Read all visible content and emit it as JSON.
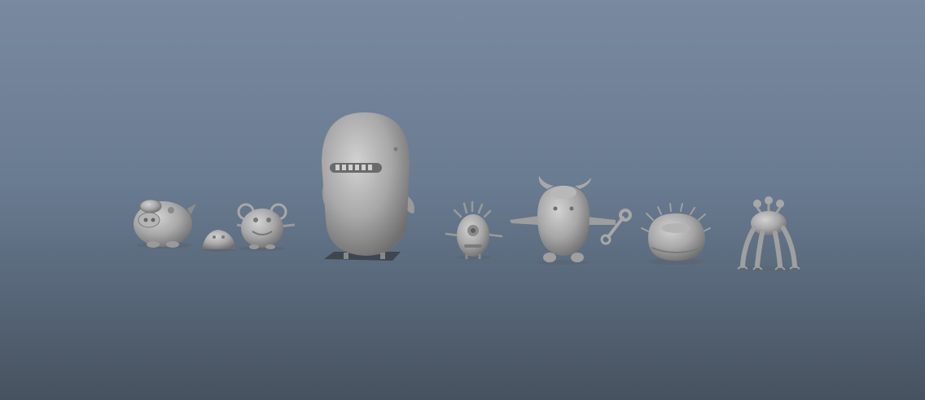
{
  "viewport": {
    "background_top": "#7889a0",
    "background_bottom": "#46525f",
    "model_color": "#a6a6a6"
  },
  "models": [
    {
      "id": "pig-monster",
      "name": "pig-monster-model"
    },
    {
      "id": "small-blob",
      "name": "small-blob-model"
    },
    {
      "id": "mouse-monster",
      "name": "mouse-monster-model"
    },
    {
      "id": "big-whale-monster",
      "name": "big-whale-monster-model"
    },
    {
      "id": "spiky-cyclops",
      "name": "spiky-cyclops-model"
    },
    {
      "id": "horned-wrench-monster",
      "name": "horned-wrench-monster-model"
    },
    {
      "id": "spiky-puffer",
      "name": "spiky-puffer-model"
    },
    {
      "id": "crab-walker",
      "name": "crab-walker-model"
    }
  ]
}
